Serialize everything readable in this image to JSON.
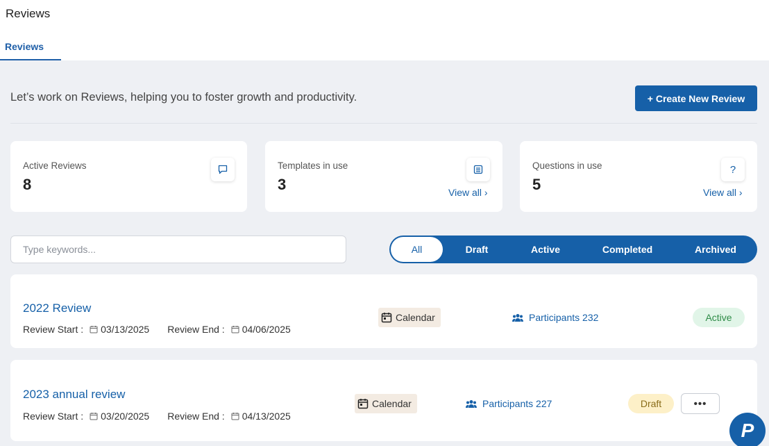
{
  "header": {
    "title": "Reviews"
  },
  "tabs": [
    {
      "label": "Reviews"
    }
  ],
  "intro": {
    "text": "Let’s work on Reviews, helping you to foster growth and productivity.",
    "create_button": "+ Create New Review"
  },
  "stats": [
    {
      "label": "Active Reviews",
      "value": "8",
      "icon": "chat-bubble-icon"
    },
    {
      "label": "Templates in use",
      "value": "3",
      "icon": "list-document-icon",
      "link": "View all ›"
    },
    {
      "label": "Questions in use",
      "value": "5",
      "icon": "question-icon",
      "link": "View all ›"
    }
  ],
  "search": {
    "placeholder": "Type keywords...",
    "value": ""
  },
  "filters": [
    {
      "label": "All",
      "selected": true
    },
    {
      "label": "Draft"
    },
    {
      "label": "Active"
    },
    {
      "label": "Completed"
    },
    {
      "label": "Archived"
    }
  ],
  "reviews": [
    {
      "title": "2022 Review",
      "start_label": "Review Start :",
      "start_date": "03/13/2025",
      "end_label": "Review End :",
      "end_date": "04/06/2025",
      "calendar_label": "Calendar",
      "participants": "Participants 232",
      "status": "Active"
    },
    {
      "title": "2023 annual review",
      "start_label": "Review Start :",
      "start_date": "03/20/2025",
      "end_label": "Review End :",
      "end_date": "04/13/2025",
      "calendar_label": "Calendar",
      "participants": "Participants 227",
      "status": "Draft",
      "more": "•••"
    }
  ],
  "fab": {
    "label": "P"
  },
  "colors": {
    "primary": "#1660a8",
    "background": "#eef0f4",
    "active_bg": "#e1f5e8",
    "draft_bg": "#fdf0c8",
    "calendar_bg": "#f3ebe2"
  }
}
